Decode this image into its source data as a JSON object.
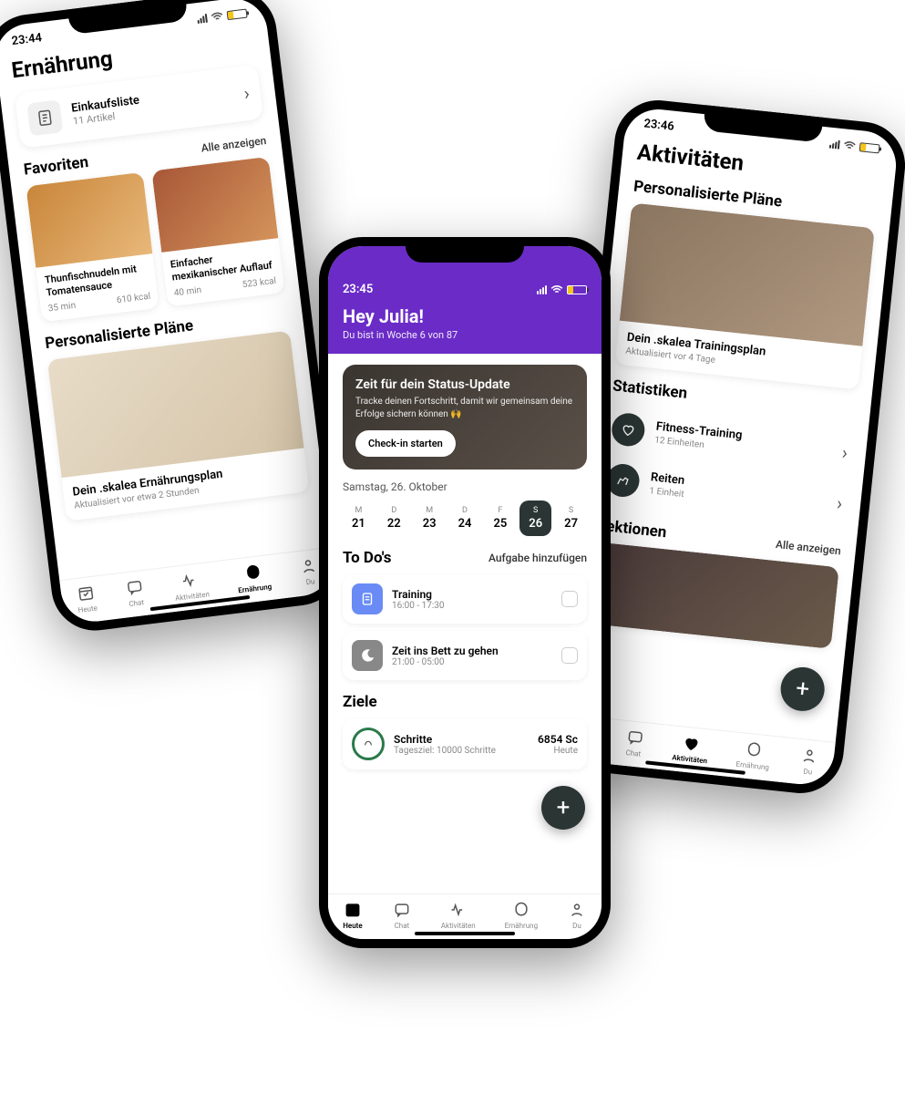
{
  "phone1": {
    "time": "23:44",
    "title": "Ernährung",
    "shopping": {
      "title": "Einkaufsliste",
      "sub": "11 Artikel"
    },
    "fav_heading": "Favoriten",
    "show_all": "Alle anzeigen",
    "foods": [
      {
        "name": "Thunfischnudeln mit Tomatensauce",
        "time": "35 min",
        "kcal": "610 kcal"
      },
      {
        "name": "Einfacher mexikanischer Auflauf",
        "time": "40 min",
        "kcal": "523 kcal"
      }
    ],
    "plans_heading": "Personalisierte Pläne",
    "plan": {
      "title": "Dein .skalea Ernährungsplan",
      "sub": "Aktualisiert vor etwa 2 Stunden"
    }
  },
  "phone2": {
    "time": "23:45",
    "greeting": "Hey Julia!",
    "week": "Du bist in Woche 6 von 87",
    "hero": {
      "title": "Zeit für dein Status-Update",
      "sub": "Tracke deinen Fortschritt, damit wir gemeinsam deine Erfolge sichern können 🙌",
      "btn": "Check-in starten"
    },
    "date": "Samstag, 26. Oktober",
    "days": [
      {
        "w": "M",
        "n": "21"
      },
      {
        "w": "D",
        "n": "22"
      },
      {
        "w": "M",
        "n": "23"
      },
      {
        "w": "D",
        "n": "24"
      },
      {
        "w": "F",
        "n": "25"
      },
      {
        "w": "S",
        "n": "26"
      },
      {
        "w": "S",
        "n": "27"
      }
    ],
    "todos_heading": "To Do's",
    "add_task": "Aufgabe hinzufügen",
    "todos": [
      {
        "title": "Training",
        "time": "16:00 - 17:30"
      },
      {
        "title": "Zeit ins Bett zu gehen",
        "time": "21:00 - 05:00"
      }
    ],
    "goals_heading": "Ziele",
    "goal": {
      "title": "Schritte",
      "sub": "Tagesziel: 10000 Schritte",
      "value": "6854 Sc",
      "when": "Heute"
    }
  },
  "phone3": {
    "time": "23:46",
    "title": "Aktivitäten",
    "plans_heading": "Personalisierte Pläne",
    "plan": {
      "title": "Dein .skalea Trainingsplan",
      "sub": "Aktualisiert vor 4 Tage"
    },
    "stats_heading": "Statistiken",
    "stats": [
      {
        "title": "Fitness-Training",
        "sub": "12 Einheiten"
      },
      {
        "title": "Reiten",
        "sub": "1 Einheit"
      }
    ],
    "lessons_heading": "Lektionen",
    "show_all": "Alle anzeigen"
  },
  "tabs": [
    {
      "label": "Heute"
    },
    {
      "label": "Chat"
    },
    {
      "label": "Aktivitäten"
    },
    {
      "label": "Ernährung"
    },
    {
      "label": "Du"
    }
  ]
}
